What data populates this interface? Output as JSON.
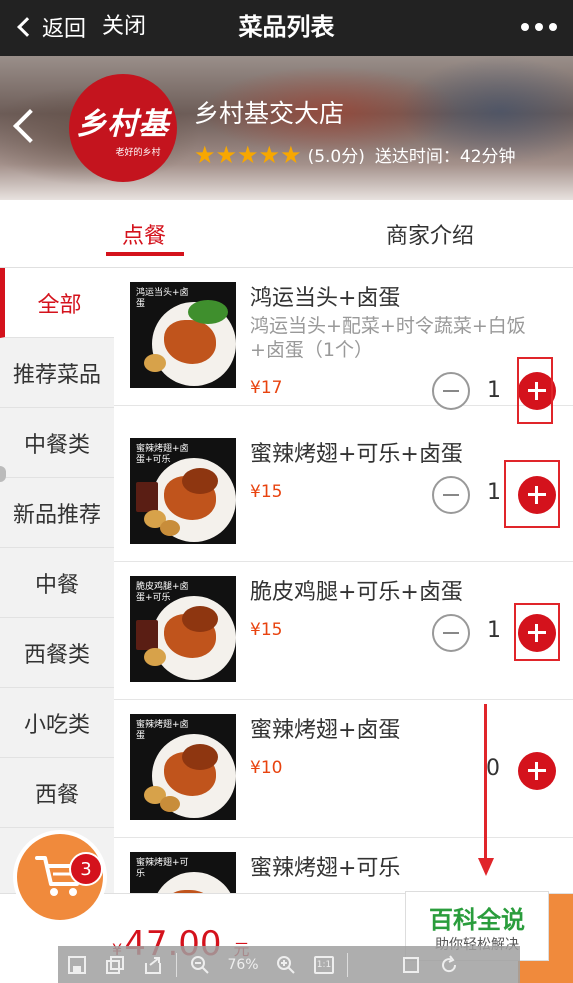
{
  "nav": {
    "back_label": "返回",
    "close_label": "关闭",
    "title": "菜品列表"
  },
  "shop": {
    "logo_text": "乡村基",
    "logo_slogan": "老好的乡村",
    "name": "乡村基交大店",
    "stars": 5,
    "score": "(5.0分)",
    "delivery": "送达时间：42分钟"
  },
  "tabs": [
    {
      "label": "点餐",
      "active": true
    },
    {
      "label": "商家介绍",
      "active": false
    }
  ],
  "categories": [
    {
      "label": "全部",
      "active": true
    },
    {
      "label": "推荐菜品"
    },
    {
      "label": "中餐类"
    },
    {
      "label": "新品推荐"
    },
    {
      "label": "中餐"
    },
    {
      "label": "西餐类"
    },
    {
      "label": "小吃类"
    },
    {
      "label": "西餐"
    }
  ],
  "dishes": [
    {
      "name": "鸿运当头+卤蛋",
      "desc": "鸿运当头+配菜+时令蔬菜+白饭+卤蛋（1个）",
      "price": "¥17",
      "qty": "1",
      "thumb_caption": "鸿运当头+卤蛋"
    },
    {
      "name": "蜜辣烤翅+可乐+卤蛋",
      "desc": "",
      "price": "¥15",
      "qty": "1",
      "thumb_caption": "蜜辣烤翅+卤蛋+可乐"
    },
    {
      "name": "脆皮鸡腿+可乐+卤蛋",
      "desc": "",
      "price": "¥15",
      "qty": "1",
      "thumb_caption": "脆皮鸡腿+卤蛋+可乐"
    },
    {
      "name": "蜜辣烤翅+卤蛋",
      "desc": "",
      "price": "¥10",
      "qty": "0",
      "thumb_caption": "蜜辣烤翅+卤蛋"
    },
    {
      "name": "蜜辣烤翅+可乐",
      "desc": "",
      "price": "",
      "qty": "",
      "thumb_caption": "蜜辣烤翅+可乐"
    }
  ],
  "cart": {
    "badge_count": "3",
    "currency": "¥",
    "total": "47.00",
    "unit": "元"
  },
  "watermark": {
    "title": "百科全说",
    "subtitle": "助你轻松解决"
  },
  "viewer": {
    "zoom": "76%",
    "ratio_label": "1:1"
  },
  "colors": {
    "accent": "#d4121c",
    "price": "#e8430f",
    "cart": "#f08a3c",
    "star": "#f7a700"
  }
}
